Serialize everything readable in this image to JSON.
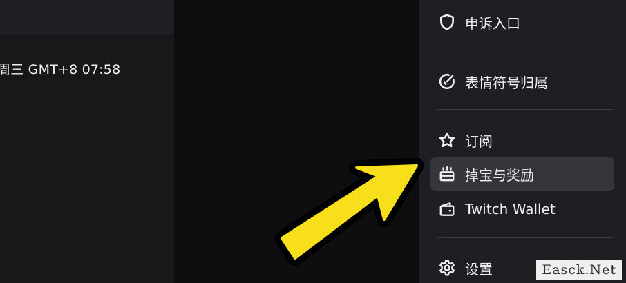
{
  "left_panel": {
    "timestamp": "周三 GMT+8 07:58"
  },
  "menu": {
    "items": [
      {
        "label": "申诉入口",
        "icon": "shield-icon"
      },
      {
        "label": "表情符号归属",
        "icon": "emote-ownership-icon"
      },
      {
        "label": "订阅",
        "icon": "star-icon"
      },
      {
        "label": "掉宝与奖励",
        "icon": "drops-rewards-icon",
        "active": true
      },
      {
        "label": "Twitch Wallet",
        "icon": "wallet-icon"
      },
      {
        "label": "设置",
        "icon": "gear-icon"
      }
    ]
  },
  "annotation": {
    "arrow_color": "#f7e01b",
    "arrow_outline": "#000000"
  },
  "watermark": {
    "text": "Easck.Net"
  },
  "colors": {
    "menu_bg": "#1f1f23",
    "active_bg": "#35353b",
    "text": "#efeff1",
    "page_bg": "#0e0e10"
  }
}
